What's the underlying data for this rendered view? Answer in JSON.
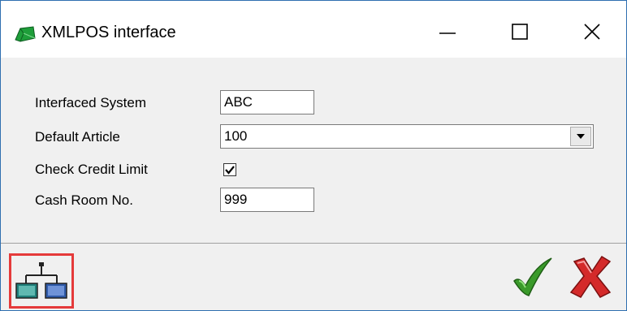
{
  "window": {
    "title": "XMLPOS interface",
    "icons": {
      "app": "interface-app-icon",
      "minimize": "minimize-icon",
      "maximize": "maximize-icon",
      "close": "close-icon"
    }
  },
  "form": {
    "interfaced_system": {
      "label": "Interfaced System",
      "value": "ABC"
    },
    "default_article": {
      "label": "Default Article",
      "value": "100",
      "dropdown_icon": "chevron-down-icon"
    },
    "check_credit_limit": {
      "label": "Check Credit Limit",
      "checked": true
    },
    "cash_room_no": {
      "label": "Cash Room No.",
      "value": "999"
    }
  },
  "footer": {
    "interface_button_icon": "network-diagram-icon",
    "ok_icon": "checkmark-icon",
    "cancel_icon": "red-x-icon",
    "highlight_color": "#e53a3a",
    "ok_color": "#3a9a2a",
    "cancel_color": "#d42a2a"
  }
}
